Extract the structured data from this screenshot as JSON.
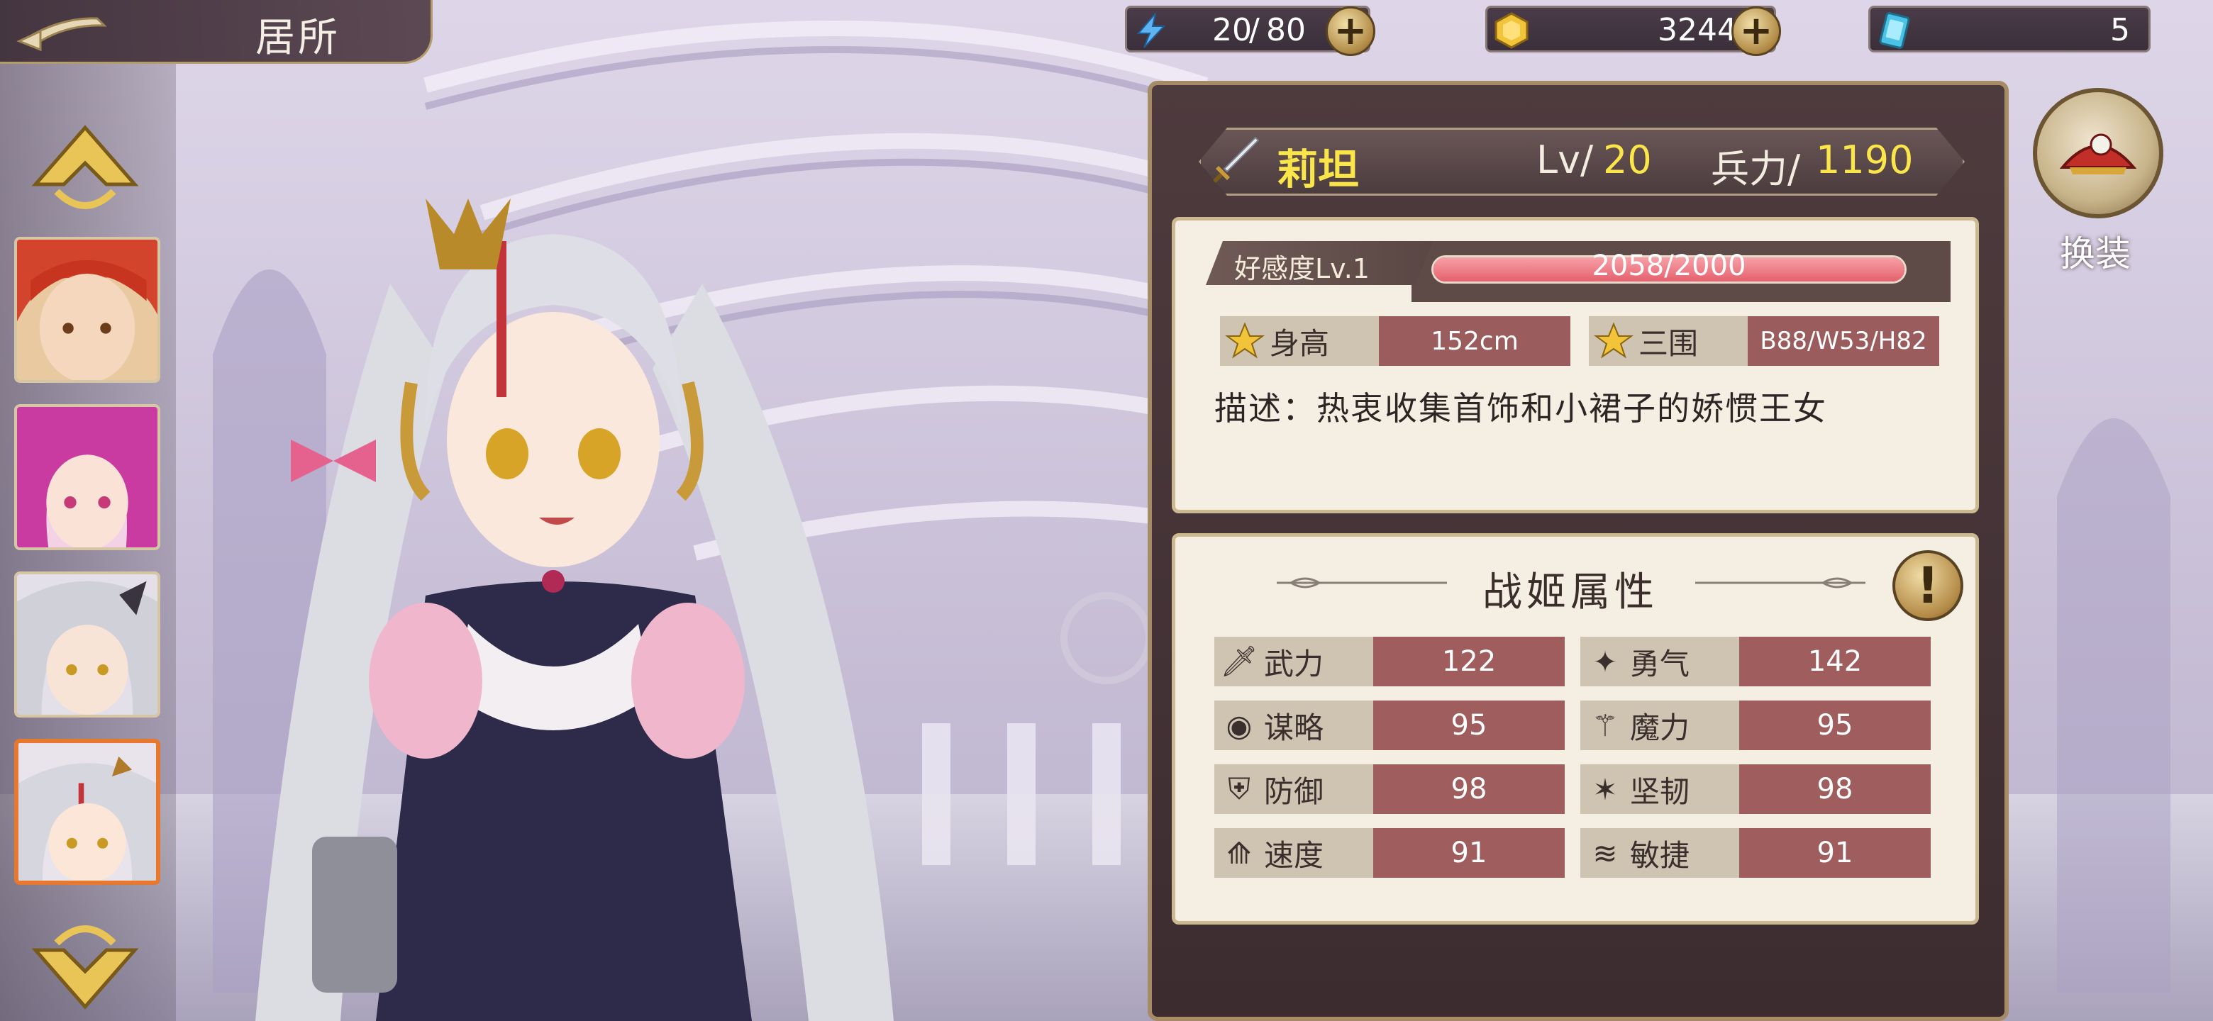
{
  "header": {
    "title": "居所"
  },
  "resources": {
    "energy": {
      "current": "20",
      "separator": "/",
      "max": "80",
      "icon": "lightning-icon"
    },
    "gold": {
      "value": "3244",
      "icon": "gold-coin-icon"
    },
    "cards": {
      "value": "5",
      "icon": "card-ticket-icon"
    }
  },
  "character": {
    "name": "莉坦",
    "level_label": "Lv/",
    "level": "20",
    "troops_label": "兵力/",
    "troops": "1190"
  },
  "affection": {
    "label": "好感度Lv.1",
    "value": "2058/2000",
    "progress": 1.0
  },
  "profile": {
    "height_label": "身高",
    "height": "152cm",
    "measures_label": "三围",
    "measures": "B88/W53/H82",
    "description": "描述：热衷收集首饰和小裙子的娇惯王女"
  },
  "attributes": {
    "title": "战姬属性",
    "items": [
      {
        "label": "武力",
        "value": "122",
        "icon": "sword-icon"
      },
      {
        "label": "勇气",
        "value": "142",
        "icon": "courage-emblem-icon"
      },
      {
        "label": "谋略",
        "value": "95",
        "icon": "mind-icon"
      },
      {
        "label": "魔力",
        "value": "95",
        "icon": "magic-staff-icon"
      },
      {
        "label": "防御",
        "value": "98",
        "icon": "shield-icon"
      },
      {
        "label": "坚韧",
        "value": "98",
        "icon": "toughness-emblem-icon"
      },
      {
        "label": "速度",
        "value": "91",
        "icon": "boot-icon"
      },
      {
        "label": "敏捷",
        "value": "91",
        "icon": "wing-icon"
      }
    ]
  },
  "outfit": {
    "label": "换装"
  },
  "colors": {
    "highlight": "#fbe64a",
    "bar_fill": "#e5606d",
    "value_cell": "#9f5d5e",
    "selected_border": "#e8782d"
  }
}
